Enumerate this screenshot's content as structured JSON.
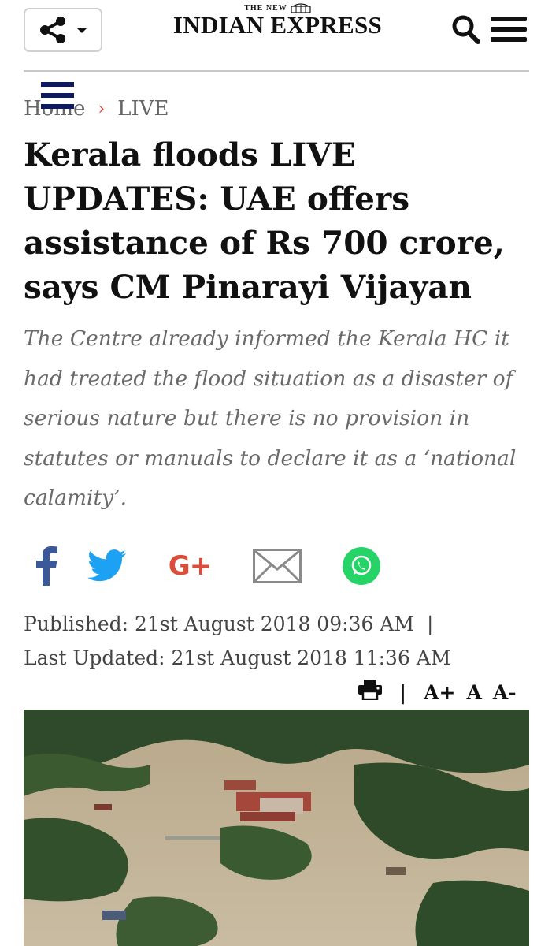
{
  "header": {
    "logo_small": "THE NEW",
    "logo_main": "INDIAN EXPRESS"
  },
  "breadcrumb": {
    "home": "Home",
    "separator": "›",
    "section": "LIVE"
  },
  "article": {
    "headline": "Kerala floods LIVE UPDATES: UAE offers assistance of Rs 700 crore, says CM Pinarayi Vijayan",
    "summary": "The Centre already informed the Kerala HC it had treated the flood situation as a disaster of serious nature but there is no provision in statutes or manuals to declare it as a ‘national calamity’.",
    "published": "Published: 21st August 2018 09:36 AM",
    "pipe": "|",
    "updated": "Last Updated: 21st August 2018 11:36 AM"
  },
  "social": {
    "icons": [
      "facebook-icon",
      "twitter-icon",
      "google-plus-icon",
      "email-icon",
      "whatsapp-icon"
    ],
    "gplus_label": "G+"
  },
  "tools": {
    "divider": "|",
    "font_increase": "A+",
    "font_default": "A",
    "font_decrease": "A-"
  },
  "colors": {
    "facebook": "#3b5998",
    "twitter": "#1da1f2",
    "google_plus": "#dd4b39",
    "email": "#8a8a8a",
    "whatsapp": "#25d366",
    "breadcrumb_separator": "#e03a2f"
  }
}
